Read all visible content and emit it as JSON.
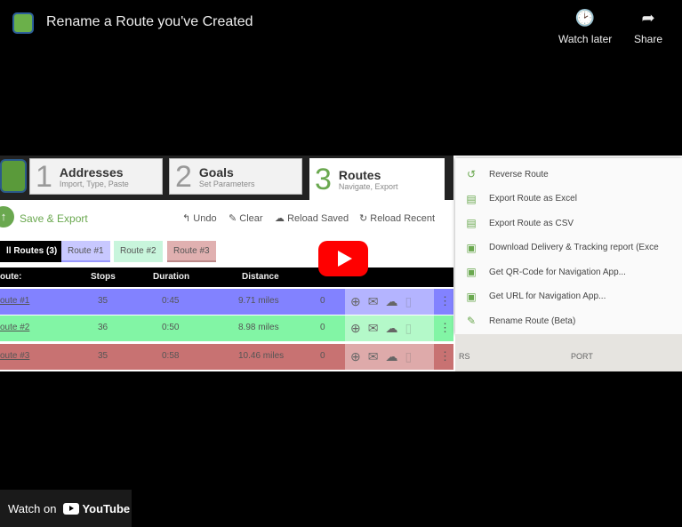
{
  "header": {
    "title": "Rename a Route you've Created",
    "watch_later": "Watch later",
    "share": "Share"
  },
  "steps": [
    {
      "num": "1",
      "title": "Addresses",
      "sub": "Import, Type, Paste"
    },
    {
      "num": "2",
      "title": "Goals",
      "sub": "Set Parameters"
    },
    {
      "num": "3",
      "title": "Routes",
      "sub": "Navigate, Export"
    }
  ],
  "toolbar": {
    "save": "Save & Export",
    "undo": "Undo",
    "clear": "Clear",
    "reload_saved": "Reload Saved",
    "reload_recent": "Reload Recent"
  },
  "route_tabs": [
    {
      "label": "ll Routes (3)",
      "color": "#000000"
    },
    {
      "label": "Route #1",
      "color": "#c8c8ff"
    },
    {
      "label": "Route #2",
      "color": "#c8f5dc"
    },
    {
      "label": "Route #3",
      "color": "#e0b0b0"
    }
  ],
  "table": {
    "headers": [
      "oute:",
      "Stops",
      "Duration",
      "Distance"
    ],
    "rows": [
      {
        "route": "oute #1",
        "stops": "35",
        "duration": "0:45",
        "distance": "9.71 miles",
        "extra": "0",
        "color": "#8282ff"
      },
      {
        "route": "oute #2",
        "stops": "36",
        "duration": "0:50",
        "distance": "8.98 miles",
        "extra": "0",
        "color": "#82f5a5"
      },
      {
        "route": "oute #3",
        "stops": "35",
        "duration": "0:58",
        "distance": "10.46 miles",
        "extra": "0",
        "color": "#c87272"
      }
    ]
  },
  "menu": [
    {
      "label": "Reverse Route",
      "icon": "reverse-icon"
    },
    {
      "label": "Export Route as Excel",
      "icon": "excel-icon"
    },
    {
      "label": "Export Route as CSV",
      "icon": "csv-icon"
    },
    {
      "label": "Download Delivery & Tracking report (Exce",
      "icon": "report-icon"
    },
    {
      "label": "Get QR-Code for Navigation App...",
      "icon": "qr-icon"
    },
    {
      "label": "Get URL for Navigation App...",
      "icon": "link-icon"
    },
    {
      "label": "Rename Route (Beta)",
      "icon": "pencil-icon"
    }
  ],
  "map": {
    "label1": "RS",
    "label2": "PORT"
  },
  "footer": {
    "watch_on": "Watch on",
    "youtube": "YouTube"
  }
}
